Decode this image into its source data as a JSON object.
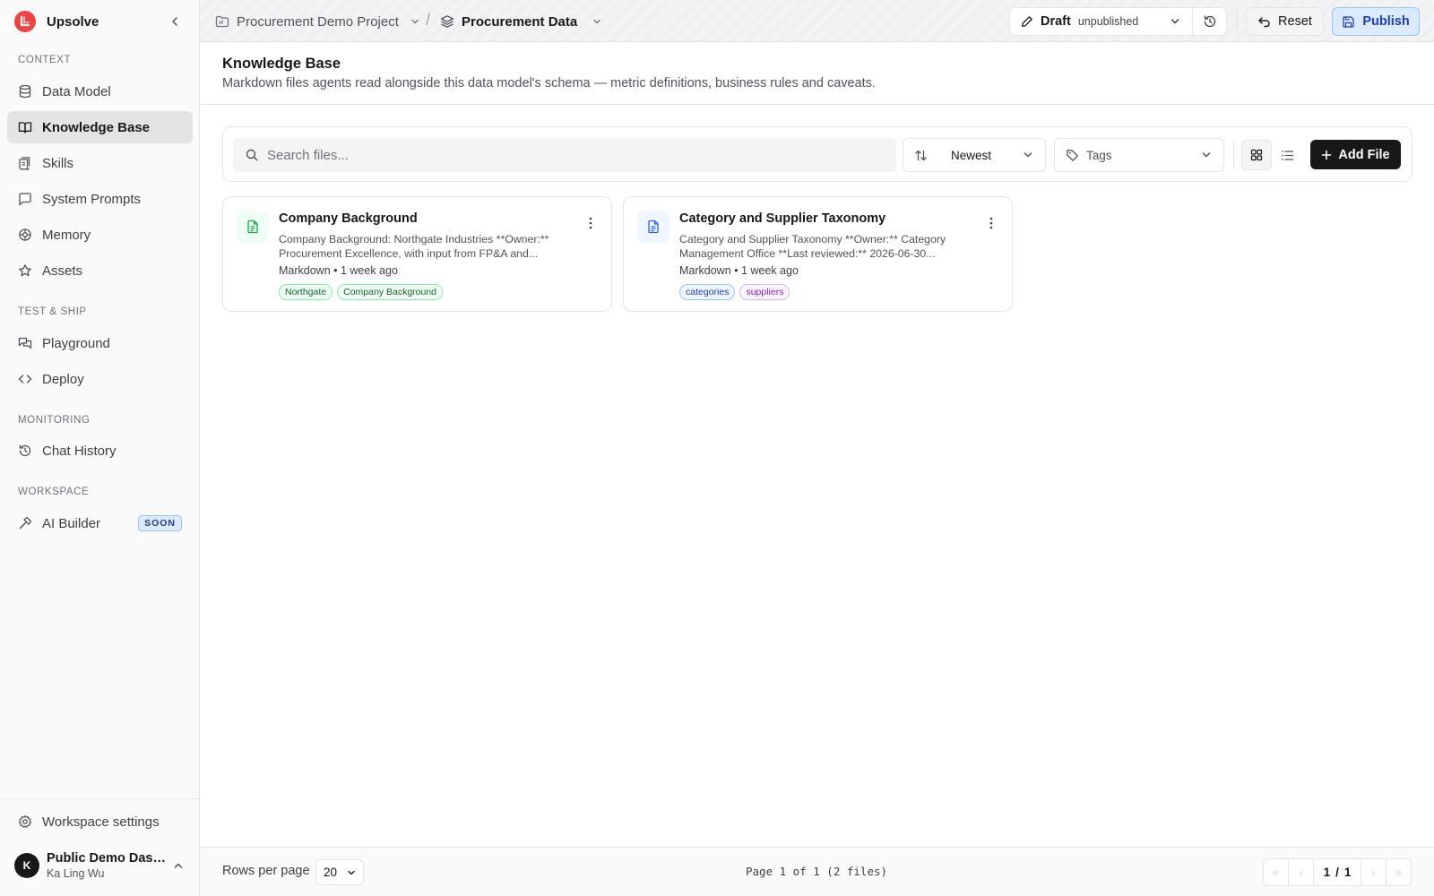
{
  "app": {
    "name": "Upsolve"
  },
  "sidebar": {
    "sections": [
      {
        "label": "CONTEXT"
      },
      {
        "label": "TEST & SHIP"
      },
      {
        "label": "MONITORING"
      },
      {
        "label": "WORKSPACE"
      }
    ],
    "items": [
      {
        "label": "Data Model",
        "icon": "database-icon"
      },
      {
        "label": "Knowledge Base",
        "icon": "book-open-icon",
        "active": true
      },
      {
        "label": "Skills",
        "icon": "scroll-icon"
      },
      {
        "label": "System Prompts",
        "icon": "message-square-icon"
      },
      {
        "label": "Memory",
        "icon": "brain-icon"
      },
      {
        "label": "Assets",
        "icon": "star-icon"
      },
      {
        "label": "Playground",
        "icon": "messages-icon"
      },
      {
        "label": "Deploy",
        "icon": "code-icon"
      },
      {
        "label": "Chat History",
        "icon": "history-icon"
      },
      {
        "label": "AI Builder",
        "icon": "hammer-icon",
        "badge": "SOON"
      }
    ],
    "settings_label": "Workspace settings",
    "user": {
      "initial": "K",
      "name": "Public Demo Dashboard",
      "subtitle": "Ka Ling Wu"
    }
  },
  "topbar": {
    "project": "Procurement Demo Project",
    "separator": "/",
    "model": "Procurement Data",
    "draft_label": "Draft",
    "draft_status": "unpublished",
    "reset_label": "Reset",
    "publish_label": "Publish"
  },
  "page": {
    "title": "Knowledge Base",
    "description": "Markdown files agents read alongside this data model's schema — metric definitions, business rules and caveats."
  },
  "toolbar": {
    "search_placeholder": "Search files...",
    "sort_value": "Newest",
    "tags_placeholder": "Tags",
    "add_label": "Add File"
  },
  "files": [
    {
      "title": "Company Background",
      "excerpt": "Company Background: Northgate Industries **Owner:** Procurement Excellence, with input from FP&A and...",
      "meta": "Markdown • 1 week ago",
      "tags": [
        "Northgate",
        "Company Background"
      ],
      "icon_color": "#16a34a"
    },
    {
      "title": "Category and Supplier Taxonomy",
      "excerpt": "Category and Supplier Taxonomy **Owner:** Category Management Office **Last reviewed:** 2026-06-30...",
      "meta": "Markdown • 1 week ago",
      "tags": [
        "categories",
        "suppliers"
      ],
      "icon_color": "#2563eb"
    }
  ],
  "footer": {
    "rows_label": "Rows per page",
    "rows_value": "20",
    "page_info": "Page 1 of 1 (2 files)",
    "current_page": "1",
    "page_sep": "/",
    "total_pages": "1"
  },
  "colors": {
    "accent": "#18181b",
    "brand": "#ef4444",
    "publish_bg": "#dbeafe"
  }
}
